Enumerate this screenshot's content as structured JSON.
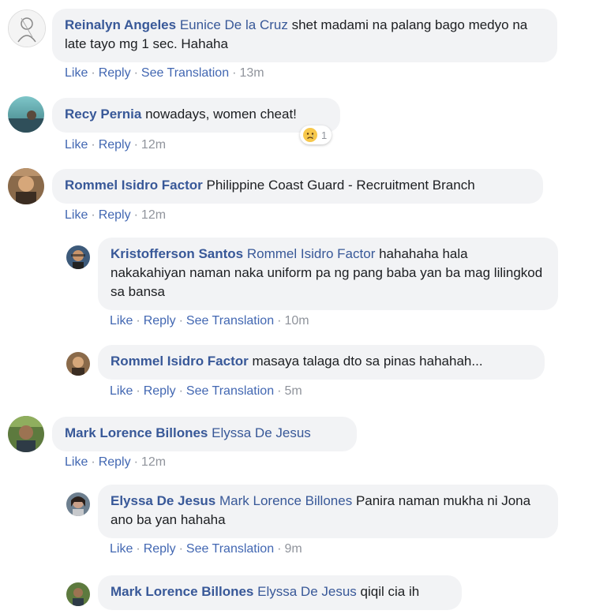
{
  "comments": [
    {
      "name": "Reinalyn Angeles",
      "mention": "Eunice De la Cruz",
      "text": "shet madami na palang bago medyo na late tayo mg 1 sec. Hahaha",
      "actions": {
        "like": "Like",
        "reply": "Reply",
        "translate": "See Translation",
        "time": "13m"
      }
    },
    {
      "name": "Recy Pernia",
      "text": "nowadays, women cheat!",
      "reaction_icon": "sad-emoji-icon",
      "reaction_count": "1",
      "actions": {
        "like": "Like",
        "reply": "Reply",
        "time": "12m"
      }
    },
    {
      "name": "Rommel Isidro Factor",
      "text": "Philippine Coast Guard - Recruitment Branch",
      "actions": {
        "like": "Like",
        "reply": "Reply",
        "time": "12m"
      },
      "replies": [
        {
          "name": "Kristofferson Santos",
          "mention": "Rommel Isidro Factor",
          "text": "hahahaha hala nakakahiyan naman naka uniform pa ng pang baba yan ba mag lilingkod sa bansa",
          "actions": {
            "like": "Like",
            "reply": "Reply",
            "translate": "See Translation",
            "time": "10m"
          }
        },
        {
          "name": "Rommel Isidro Factor",
          "text": "masaya talaga dto sa pinas hahahah...",
          "actions": {
            "like": "Like",
            "reply": "Reply",
            "translate": "See Translation",
            "time": "5m"
          }
        }
      ]
    },
    {
      "name": "Mark Lorence Billones",
      "mention": "Elyssa De Jesus",
      "actions": {
        "like": "Like",
        "reply": "Reply",
        "time": "12m"
      },
      "replies": [
        {
          "name": "Elyssa De Jesus",
          "mention": "Mark Lorence Billones",
          "text": "Panira naman mukha ni Jona ano ba yan hahaha",
          "actions": {
            "like": "Like",
            "reply": "Reply",
            "translate": "See Translation",
            "time": "9m"
          }
        },
        {
          "name": "Mark Lorence Billones",
          "mention": "Elyssa De Jesus",
          "text": "qiqil cia ih"
        }
      ]
    }
  ],
  "colors": {
    "name": "#385898",
    "link": "#4267b2",
    "meta": "#90949c",
    "bubble": "#f2f3f5"
  }
}
